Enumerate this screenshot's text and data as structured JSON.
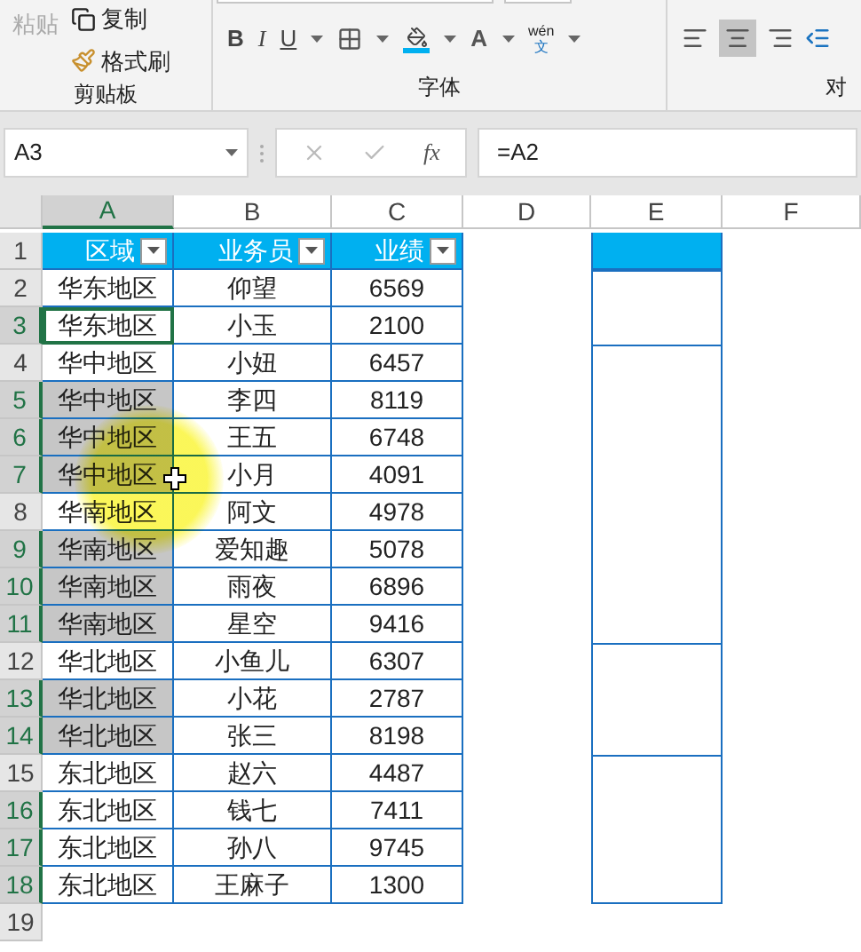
{
  "ribbon": {
    "clipboard": {
      "paste": "粘贴",
      "copy": "复制",
      "format_painter": "格式刷",
      "label": "剪贴板"
    },
    "font": {
      "bold": "B",
      "italic": "I",
      "underline": "U",
      "phonetic_top": "wén",
      "phonetic_bottom": "文",
      "font_color": "A",
      "label": "字体"
    },
    "alignment": {
      "label": "对"
    }
  },
  "formula_bar": {
    "name_box": "A3",
    "fx": "fx",
    "formula": "=A2"
  },
  "columns": [
    {
      "label": "A",
      "selected": true
    },
    {
      "label": "B",
      "selected": false
    },
    {
      "label": "C",
      "selected": false
    },
    {
      "label": "D",
      "selected": false
    },
    {
      "label": "E",
      "selected": false
    },
    {
      "label": "F",
      "selected": false
    }
  ],
  "header": {
    "row": "1",
    "cells": [
      "区域",
      "业务员",
      "业绩"
    ]
  },
  "rows": [
    {
      "row": "2",
      "cells": [
        "华东地区",
        "仰望",
        "6569"
      ],
      "active": false,
      "shaded": false,
      "selected": false,
      "e_top": true
    },
    {
      "row": "3",
      "cells": [
        "华东地区",
        "小玉",
        "2100"
      ],
      "active": true,
      "shaded": false,
      "selected": true,
      "e_top": false
    },
    {
      "row": "4",
      "cells": [
        "华中地区",
        "小妞",
        "6457"
      ],
      "active": false,
      "shaded": false,
      "selected": false,
      "e_top": true
    },
    {
      "row": "5",
      "cells": [
        "华中地区",
        "李四",
        "8119"
      ],
      "active": false,
      "shaded": true,
      "selected": true,
      "e_top": false
    },
    {
      "row": "6",
      "cells": [
        "华中地区",
        "王五",
        "6748"
      ],
      "active": false,
      "shaded": true,
      "selected": true,
      "e_top": false
    },
    {
      "row": "7",
      "cells": [
        "华中地区",
        "小月",
        "4091"
      ],
      "active": false,
      "shaded": true,
      "selected": true,
      "e_top": false
    },
    {
      "row": "8",
      "cells": [
        "华南地区",
        "阿文",
        "4978"
      ],
      "active": false,
      "shaded": false,
      "selected": false,
      "e_top": false
    },
    {
      "row": "9",
      "cells": [
        "华南地区",
        "爱知趣",
        "5078"
      ],
      "active": false,
      "shaded": true,
      "selected": true,
      "e_top": false
    },
    {
      "row": "10",
      "cells": [
        "华南地区",
        "雨夜",
        "6896"
      ],
      "active": false,
      "shaded": true,
      "selected": true,
      "e_top": false
    },
    {
      "row": "11",
      "cells": [
        "华南地区",
        "星空",
        "9416"
      ],
      "active": false,
      "shaded": true,
      "selected": true,
      "e_top": false
    },
    {
      "row": "12",
      "cells": [
        "华北地区",
        "小鱼儿",
        "6307"
      ],
      "active": false,
      "shaded": false,
      "selected": false,
      "e_top": true
    },
    {
      "row": "13",
      "cells": [
        "华北地区",
        "小花",
        "2787"
      ],
      "active": false,
      "shaded": true,
      "selected": true,
      "e_top": false
    },
    {
      "row": "14",
      "cells": [
        "华北地区",
        "张三",
        "8198"
      ],
      "active": false,
      "shaded": true,
      "selected": true,
      "e_top": false
    },
    {
      "row": "15",
      "cells": [
        "东北地区",
        "赵六",
        "4487"
      ],
      "active": false,
      "shaded": false,
      "selected": false,
      "e_top": true
    },
    {
      "row": "16",
      "cells": [
        "东北地区",
        "钱七",
        "7411"
      ],
      "active": false,
      "shaded": false,
      "selected": true,
      "e_top": false
    },
    {
      "row": "17",
      "cells": [
        "东北地区",
        "孙八",
        "9745"
      ],
      "active": false,
      "shaded": false,
      "selected": true,
      "e_top": false
    },
    {
      "row": "18",
      "cells": [
        "东北地区",
        "王麻子",
        "1300"
      ],
      "active": false,
      "shaded": false,
      "selected": true,
      "e_top": false
    }
  ],
  "empty_rows": [
    "19"
  ]
}
